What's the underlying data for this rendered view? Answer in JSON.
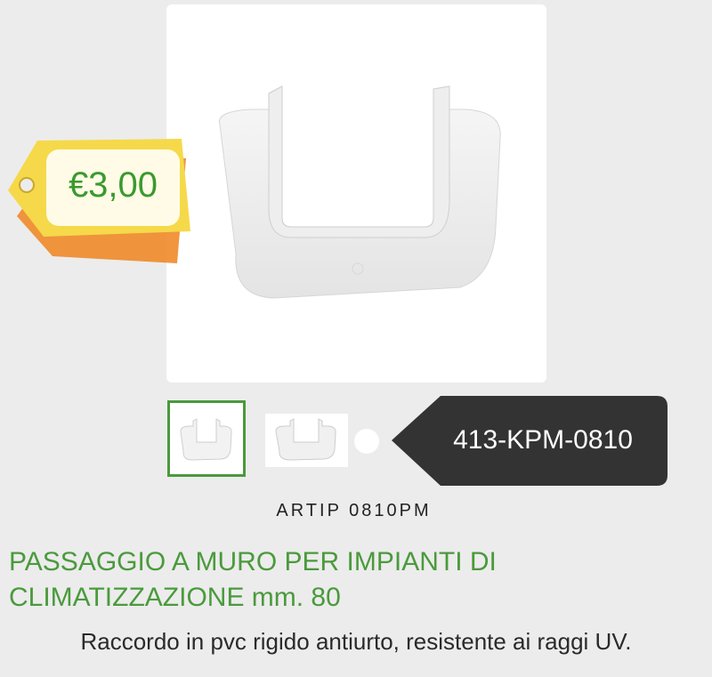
{
  "price": {
    "label": "€3,00"
  },
  "product": {
    "sku": "413-KPM-0810",
    "code": "ARTIP 0810PM",
    "title_line1": "PASSAGGIO A MURO PER IMPIANTI DI",
    "title_line2": "CLIMATIZZAZIONE mm. 80",
    "description": "Raccordo in pvc rigido antiurto, resistente ai raggi UV."
  },
  "gallery": {
    "selected_index": 0,
    "dots": 1
  },
  "colors": {
    "accent": "#4a9a3c",
    "badge": "#333333",
    "price_tag_front": "#f5d94a",
    "price_tag_back": "#f08a2a"
  },
  "icons": {
    "price_tag": "price-tag-icon",
    "product_image": "wall-passage-fitting-image"
  }
}
